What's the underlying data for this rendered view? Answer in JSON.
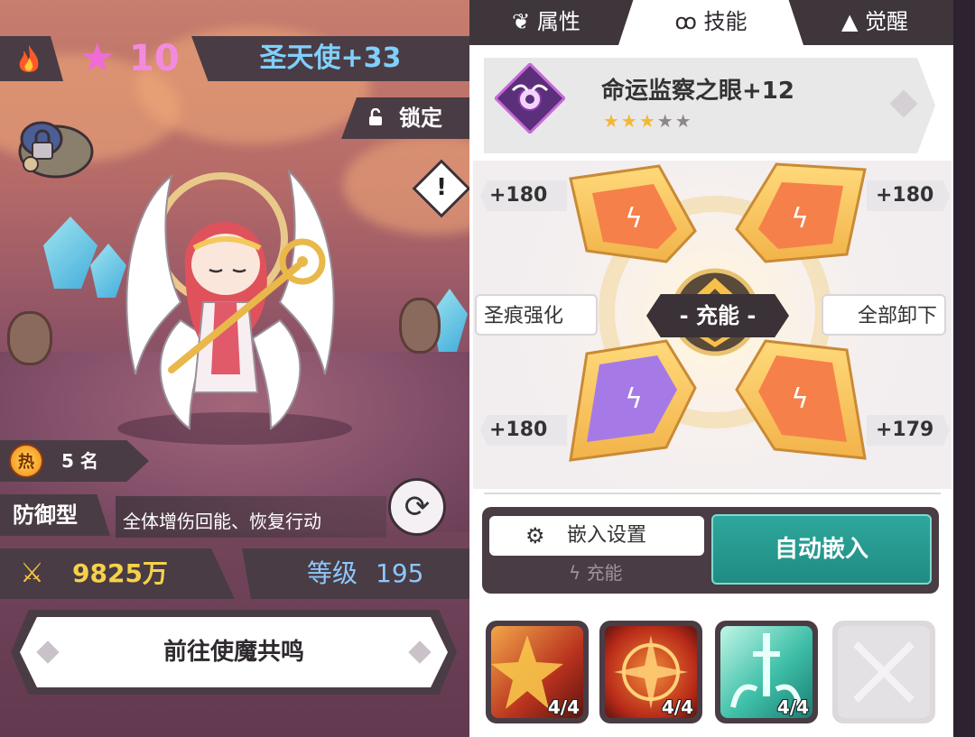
{
  "header": {
    "star_count": "10",
    "character_name": "圣天使+33",
    "lock_label": "锁定"
  },
  "character": {
    "heat_badge": "热",
    "heat_rank": "5 名",
    "type": "防御型",
    "description": "全体增伤回能、恢复行动",
    "power": "9825万",
    "level_label": "等级",
    "level_value": "195"
  },
  "actions": {
    "resonate": "前往使魔共鸣",
    "embed_settings": "嵌入设置",
    "charge_label": "充能",
    "auto_embed": "自动嵌入",
    "enhance": "圣痕强化",
    "unload_all": "全部卸下"
  },
  "tabs": [
    {
      "label": "属性",
      "icon": "attribute-icon"
    },
    {
      "label": "技能",
      "icon": "skill-icon"
    },
    {
      "label": "觉醒",
      "icon": "awaken-icon"
    }
  ],
  "skill": {
    "name": "命运监察之眼+12",
    "stars_filled": 3,
    "stars_total": 5,
    "stars_text": "★★★★★"
  },
  "gems": {
    "center_label": "- 充能 -",
    "bonus_top_left": "+180",
    "bonus_top_right": "+180",
    "bonus_bottom_left": "+180",
    "bonus_bottom_right": "+179",
    "colors": {
      "orange": "#f6804a",
      "purple": "#a67ae6",
      "gold": "#f7c24a"
    }
  },
  "runes": [
    {
      "count": "4/4",
      "theme": "red-star"
    },
    {
      "count": "4/4",
      "theme": "red-cross"
    },
    {
      "count": "4/4",
      "theme": "teal-sword"
    },
    {
      "count": "",
      "theme": "empty-slot"
    }
  ],
  "colors": {
    "teal": "#22958a",
    "dark_banner": "#4a3c44",
    "star_pink": "#f06bd8",
    "name_blue": "#7fd0ff"
  }
}
